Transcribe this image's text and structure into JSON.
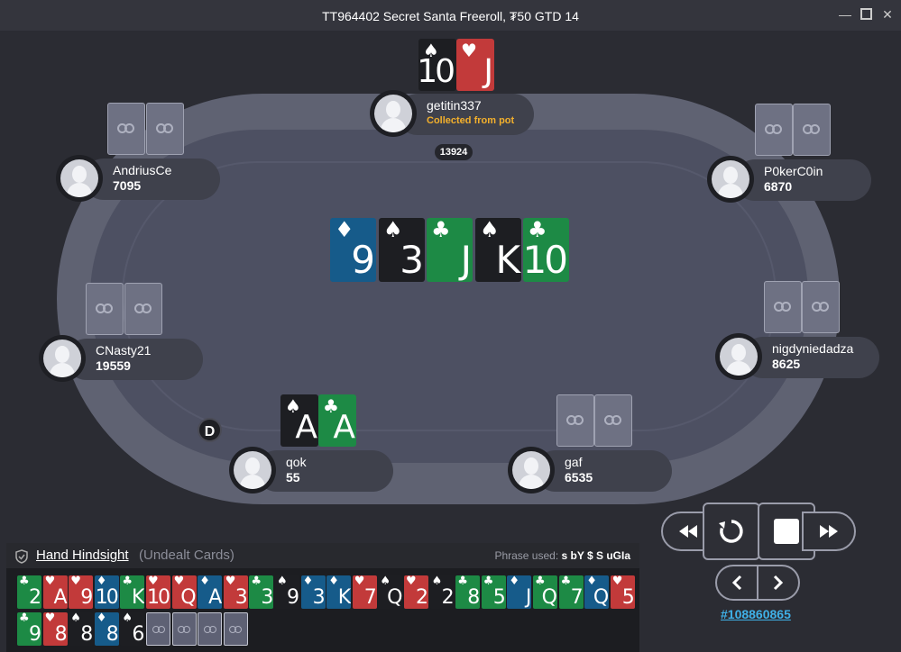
{
  "window": {
    "title": "TT964402 Secret Santa Freeroll, ₮50 GTD 14"
  },
  "table": {
    "pot": "13924",
    "dealer_label": "D",
    "board": [
      {
        "rank": "9",
        "suit": "♦",
        "color": "blue"
      },
      {
        "rank": "3",
        "suit": "♠",
        "color": "black"
      },
      {
        "rank": "J",
        "suit": "♣",
        "color": "green"
      },
      {
        "rank": "K",
        "suit": "♠",
        "color": "black"
      },
      {
        "rank": "10",
        "suit": "♣",
        "color": "green"
      }
    ]
  },
  "players": [
    {
      "name": "getitin337",
      "note": "Collected from pot",
      "cards": [
        {
          "rank": "10",
          "suit": "♠",
          "color": "black"
        },
        {
          "rank": "J",
          "suit": "♥",
          "color": "red"
        }
      ]
    },
    {
      "name": "AndriusCe",
      "stack": "7095"
    },
    {
      "name": "P0kerC0in",
      "stack": "6870"
    },
    {
      "name": "CNasty21",
      "stack": "19559"
    },
    {
      "name": "nigdyniedadza",
      "stack": "8625"
    },
    {
      "name": "qok",
      "stack": "55",
      "cards": [
        {
          "rank": "A",
          "suit": "♠",
          "color": "black"
        },
        {
          "rank": "A",
          "suit": "♣",
          "color": "green"
        }
      ]
    },
    {
      "name": "gaf",
      "stack": "6535"
    }
  ],
  "hindsight": {
    "title": "Hand Hindsight",
    "subtitle": "(Undealt Cards)",
    "phrase_label": "Phrase used:",
    "phrase": "s bY $ S uGIa",
    "cards": [
      {
        "rank": "2",
        "suit": "♣",
        "color": "green"
      },
      {
        "rank": "A",
        "suit": "♥",
        "color": "red"
      },
      {
        "rank": "9",
        "suit": "♥",
        "color": "red"
      },
      {
        "rank": "10",
        "suit": "♦",
        "color": "blue"
      },
      {
        "rank": "K",
        "suit": "♣",
        "color": "green"
      },
      {
        "rank": "10",
        "suit": "♥",
        "color": "red"
      },
      {
        "rank": "Q",
        "suit": "♥",
        "color": "red"
      },
      {
        "rank": "A",
        "suit": "♦",
        "color": "blue"
      },
      {
        "rank": "3",
        "suit": "♥",
        "color": "red"
      },
      {
        "rank": "3",
        "suit": "♣",
        "color": "green"
      },
      {
        "rank": "9",
        "suit": "♠",
        "color": "black"
      },
      {
        "rank": "3",
        "suit": "♦",
        "color": "blue"
      },
      {
        "rank": "K",
        "suit": "♦",
        "color": "blue"
      },
      {
        "rank": "7",
        "suit": "♥",
        "color": "red"
      },
      {
        "rank": "Q",
        "suit": "♠",
        "color": "black"
      },
      {
        "rank": "2",
        "suit": "♥",
        "color": "red"
      },
      {
        "rank": "2",
        "suit": "♠",
        "color": "black"
      },
      {
        "rank": "8",
        "suit": "♣",
        "color": "green"
      },
      {
        "rank": "5",
        "suit": "♣",
        "color": "green"
      },
      {
        "rank": "J",
        "suit": "♦",
        "color": "blue"
      },
      {
        "rank": "Q",
        "suit": "♣",
        "color": "green"
      },
      {
        "rank": "7",
        "suit": "♣",
        "color": "green"
      },
      {
        "rank": "Q",
        "suit": "♦",
        "color": "blue"
      },
      {
        "rank": "5",
        "suit": "♥",
        "color": "red"
      },
      {
        "rank": "9",
        "suit": "♣",
        "color": "green"
      },
      {
        "rank": "8",
        "suit": "♥",
        "color": "red"
      },
      {
        "rank": "8",
        "suit": "♠",
        "color": "black"
      },
      {
        "rank": "8",
        "suit": "♦",
        "color": "blue"
      },
      {
        "rank": "6",
        "suit": "♠",
        "color": "black"
      },
      {
        "back": true
      },
      {
        "back": true
      },
      {
        "back": true
      },
      {
        "back": true
      }
    ]
  },
  "replay": {
    "hand_link": "#108860865",
    "buttons": [
      "rewind-icon",
      "replay-icon",
      "stop-icon",
      "fast-forward-icon",
      "step-back-icon",
      "step-forward-icon"
    ]
  },
  "colors": {
    "black": "#1d1e22",
    "red": "#c23a3a",
    "blue": "#165b8a",
    "green": "#1d8a45",
    "link": "#3fb1e8",
    "note": "#f3b02c"
  }
}
